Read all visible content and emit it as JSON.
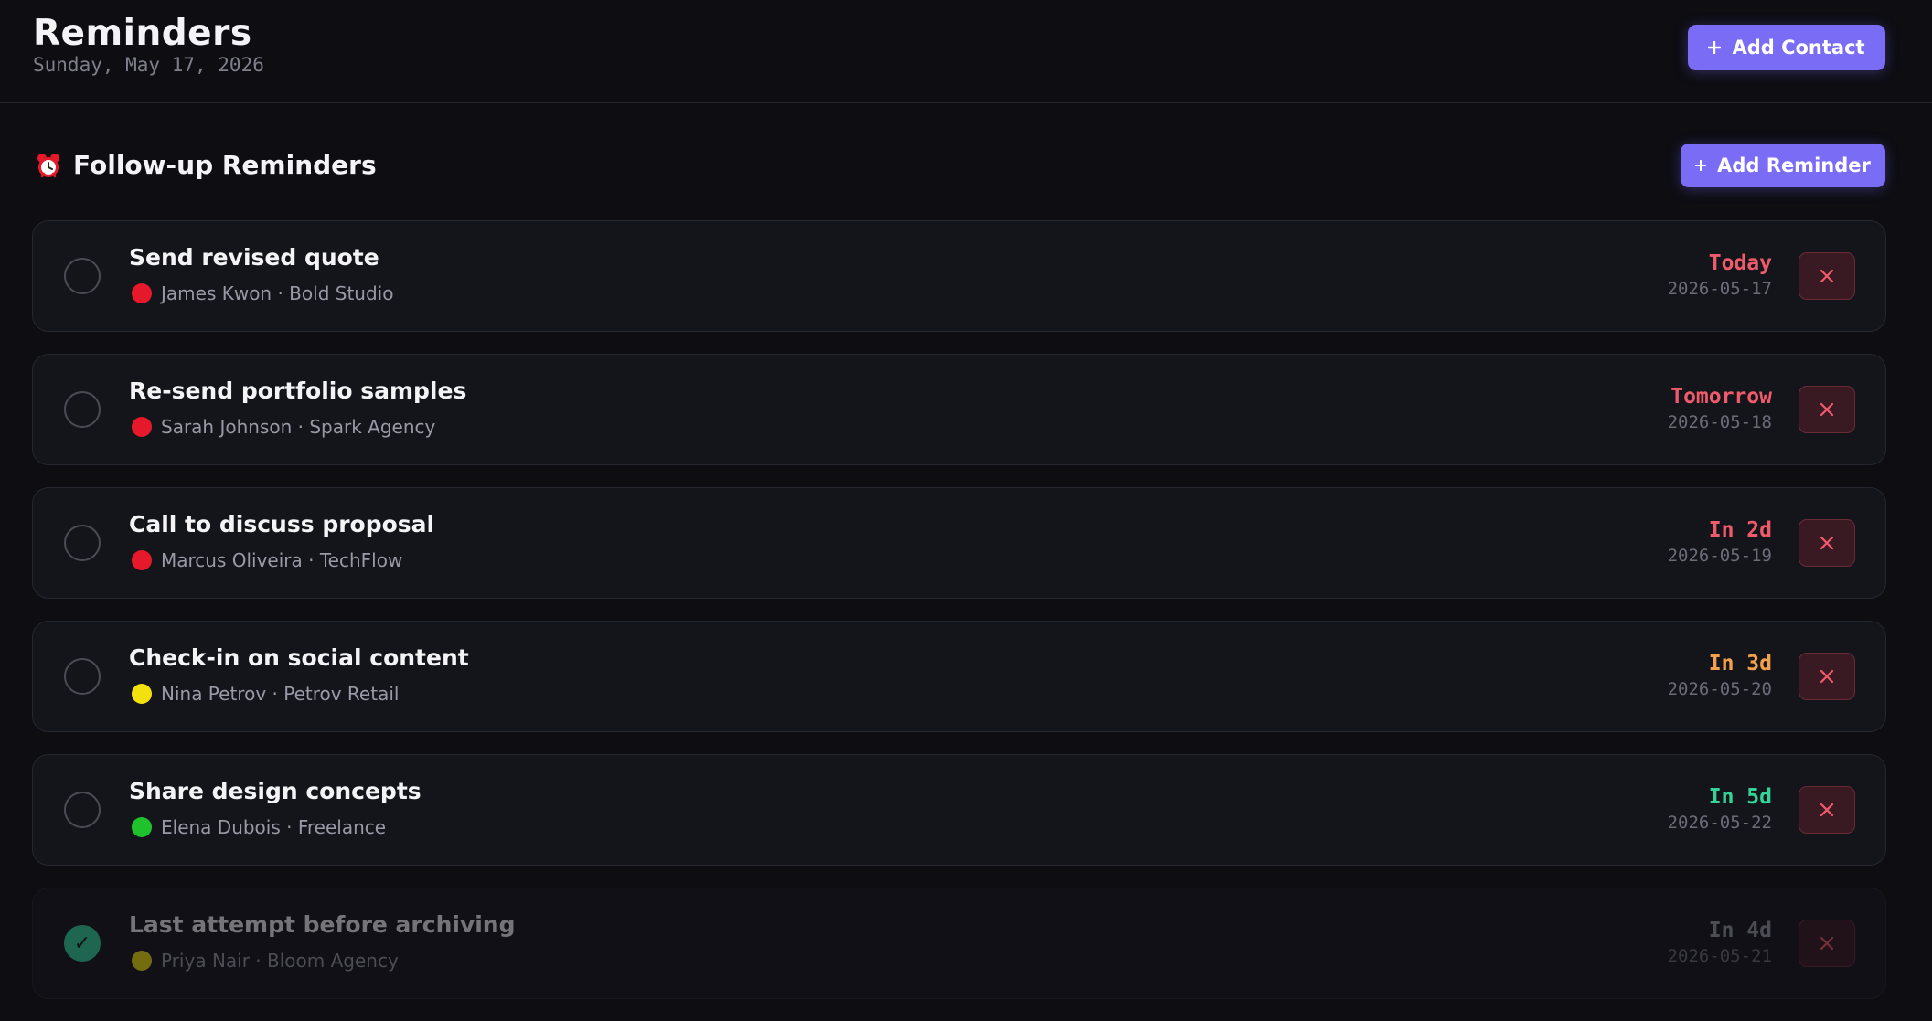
{
  "header": {
    "title": "Reminders",
    "date": "Sunday, May 17, 2026",
    "add_contact_label": "Add Contact",
    "add_contact_icon": "plus-icon"
  },
  "section": {
    "icon": "alarm-clock-icon",
    "title": "Follow-up Reminders",
    "add_reminder_label": "Add Reminder",
    "add_reminder_icon": "plus-icon"
  },
  "colors": {
    "accent": "#7b6cf6",
    "background": "#0d0d12",
    "card": "#14151b",
    "due_urgent": "#f05b6b",
    "due_soon": "#f5a04a",
    "due_later": "#34d399",
    "priority_high": "#e5192a",
    "priority_medium": "#f2e10c",
    "priority_low": "#1fc22c",
    "delete": "#f05b6b"
  },
  "reminders": [
    {
      "title": "Send revised quote",
      "contact": "James Kwon",
      "company": "Bold Studio",
      "subtitle": "James Kwon · Bold Studio",
      "priority": "high",
      "due_label": "Today",
      "due_date": "2026-05-17",
      "due_color": "#f05b6b",
      "completed": false
    },
    {
      "title": "Re-send portfolio samples",
      "contact": "Sarah Johnson",
      "company": "Spark Agency",
      "subtitle": "Sarah Johnson · Spark Agency",
      "priority": "high",
      "due_label": "Tomorrow",
      "due_date": "2026-05-18",
      "due_color": "#f05b6b",
      "completed": false
    },
    {
      "title": "Call to discuss proposal",
      "contact": "Marcus Oliveira",
      "company": "TechFlow",
      "subtitle": "Marcus Oliveira · TechFlow",
      "priority": "high",
      "due_label": "In 2d",
      "due_date": "2026-05-19",
      "due_color": "#f05b6b",
      "completed": false
    },
    {
      "title": "Check-in on social content",
      "contact": "Nina Petrov",
      "company": "Petrov Retail",
      "subtitle": "Nina Petrov · Petrov Retail",
      "priority": "medium",
      "due_label": "In 3d",
      "due_date": "2026-05-20",
      "due_color": "#f5a04a",
      "completed": false
    },
    {
      "title": "Share design concepts",
      "contact": "Elena Dubois",
      "company": "Freelance",
      "subtitle": "Elena Dubois · Freelance",
      "priority": "low",
      "due_label": "In 5d",
      "due_date": "2026-05-22",
      "due_color": "#34d399",
      "completed": false
    },
    {
      "title": "Last attempt before archiving",
      "contact": "Priya Nair",
      "company": "Bloom Agency",
      "subtitle": "Priya Nair · Bloom Agency",
      "priority": "medium",
      "due_label": "In 4d",
      "due_date": "2026-05-21",
      "due_color": "#9a9aa6",
      "completed": true,
      "check_glyph": "✓"
    }
  ]
}
